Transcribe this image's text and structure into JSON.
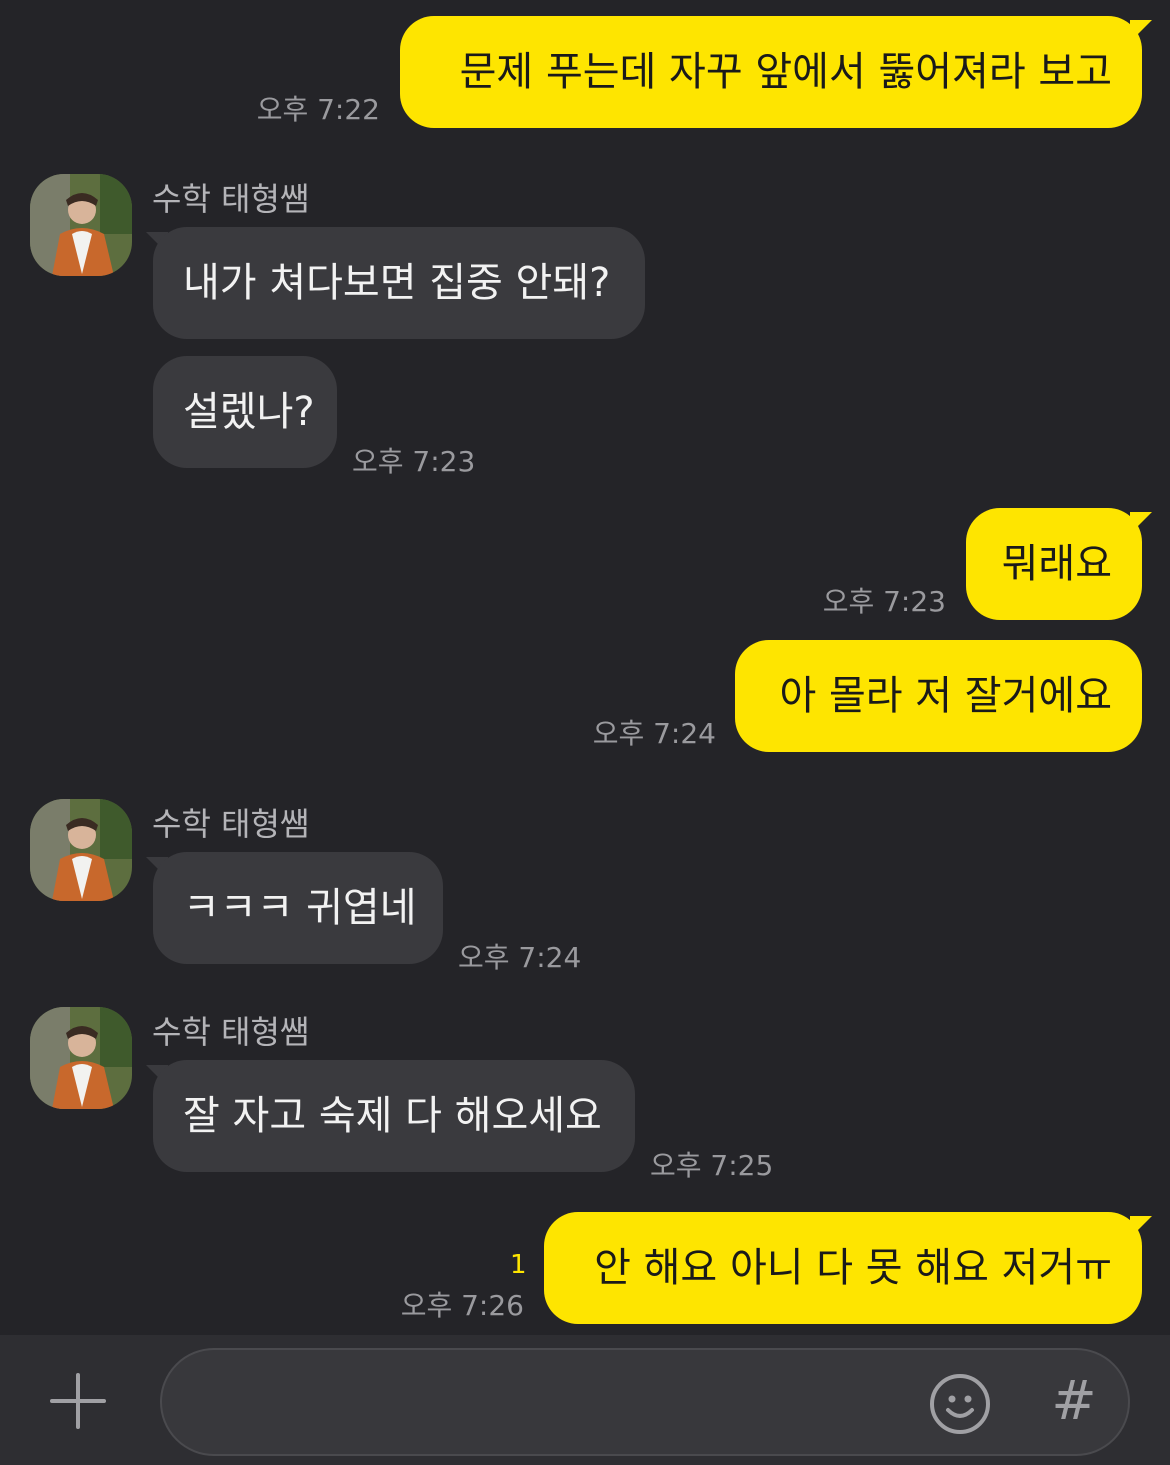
{
  "colors": {
    "background": "#242428",
    "my_bubble": "#FEE500",
    "their_bubble": "#3a3a3e",
    "timestamp": "#9a9a9e",
    "unread_count": "#FEE500"
  },
  "contact": {
    "name": "수학 태형쌤"
  },
  "messages": [
    {
      "from": "me",
      "text": "문제 푸는데 자꾸 앞에서 뚫어져라 보고",
      "time": "오후 7:22"
    },
    {
      "from": "them",
      "text": "내가 쳐다보면 집중 안돼?",
      "time": ""
    },
    {
      "from": "them",
      "text": "설렜나?",
      "time": "오후 7:23"
    },
    {
      "from": "me",
      "text": "뭐래요",
      "time": "오후 7:23"
    },
    {
      "from": "me",
      "text": "아 몰라 저 잘거에요",
      "time": "오후 7:24"
    },
    {
      "from": "them",
      "text": "ㅋㅋㅋ 귀엽네",
      "time": "오후 7:24"
    },
    {
      "from": "them",
      "text": "잘 자고 숙제 다 해오세요",
      "time": "오후 7:25"
    },
    {
      "from": "me",
      "text": "안 해요 아니 다 못 해요 저거ㅠ",
      "time": "오후 7:26",
      "unread": "1"
    }
  ],
  "composer": {
    "input_value": "",
    "plus_icon": "plus-icon",
    "emoji_icon": "smiley-icon",
    "hash_label": "#"
  }
}
